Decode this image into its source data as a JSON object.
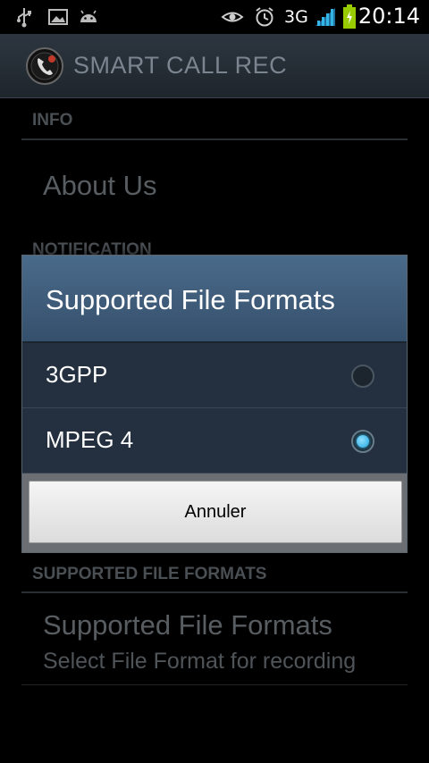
{
  "status_bar": {
    "network": "3G",
    "time": "20:14",
    "icons": [
      "usb-icon",
      "image-icon",
      "android-icon",
      "eye-icon",
      "alarm-icon",
      "signal-icon",
      "battery-charging-icon"
    ]
  },
  "app": {
    "title": "SMART CALL REC"
  },
  "preferences": {
    "info_category": "INFO",
    "about_title": "About Us",
    "notification_category": "NOTIFICATION",
    "formats_category": "SUPPORTED FILE FORMATS",
    "formats_title": "Supported File Formats",
    "formats_summary": "Select File Format for recording"
  },
  "dialog": {
    "title": "Supported File Formats",
    "options": [
      {
        "label": "3GPP",
        "checked": false
      },
      {
        "label": "MPEG 4",
        "checked": true
      }
    ],
    "cancel_label": "Annuler"
  },
  "colors": {
    "accent": "#33b5e5",
    "dialog_header": "#4a6a8a"
  }
}
